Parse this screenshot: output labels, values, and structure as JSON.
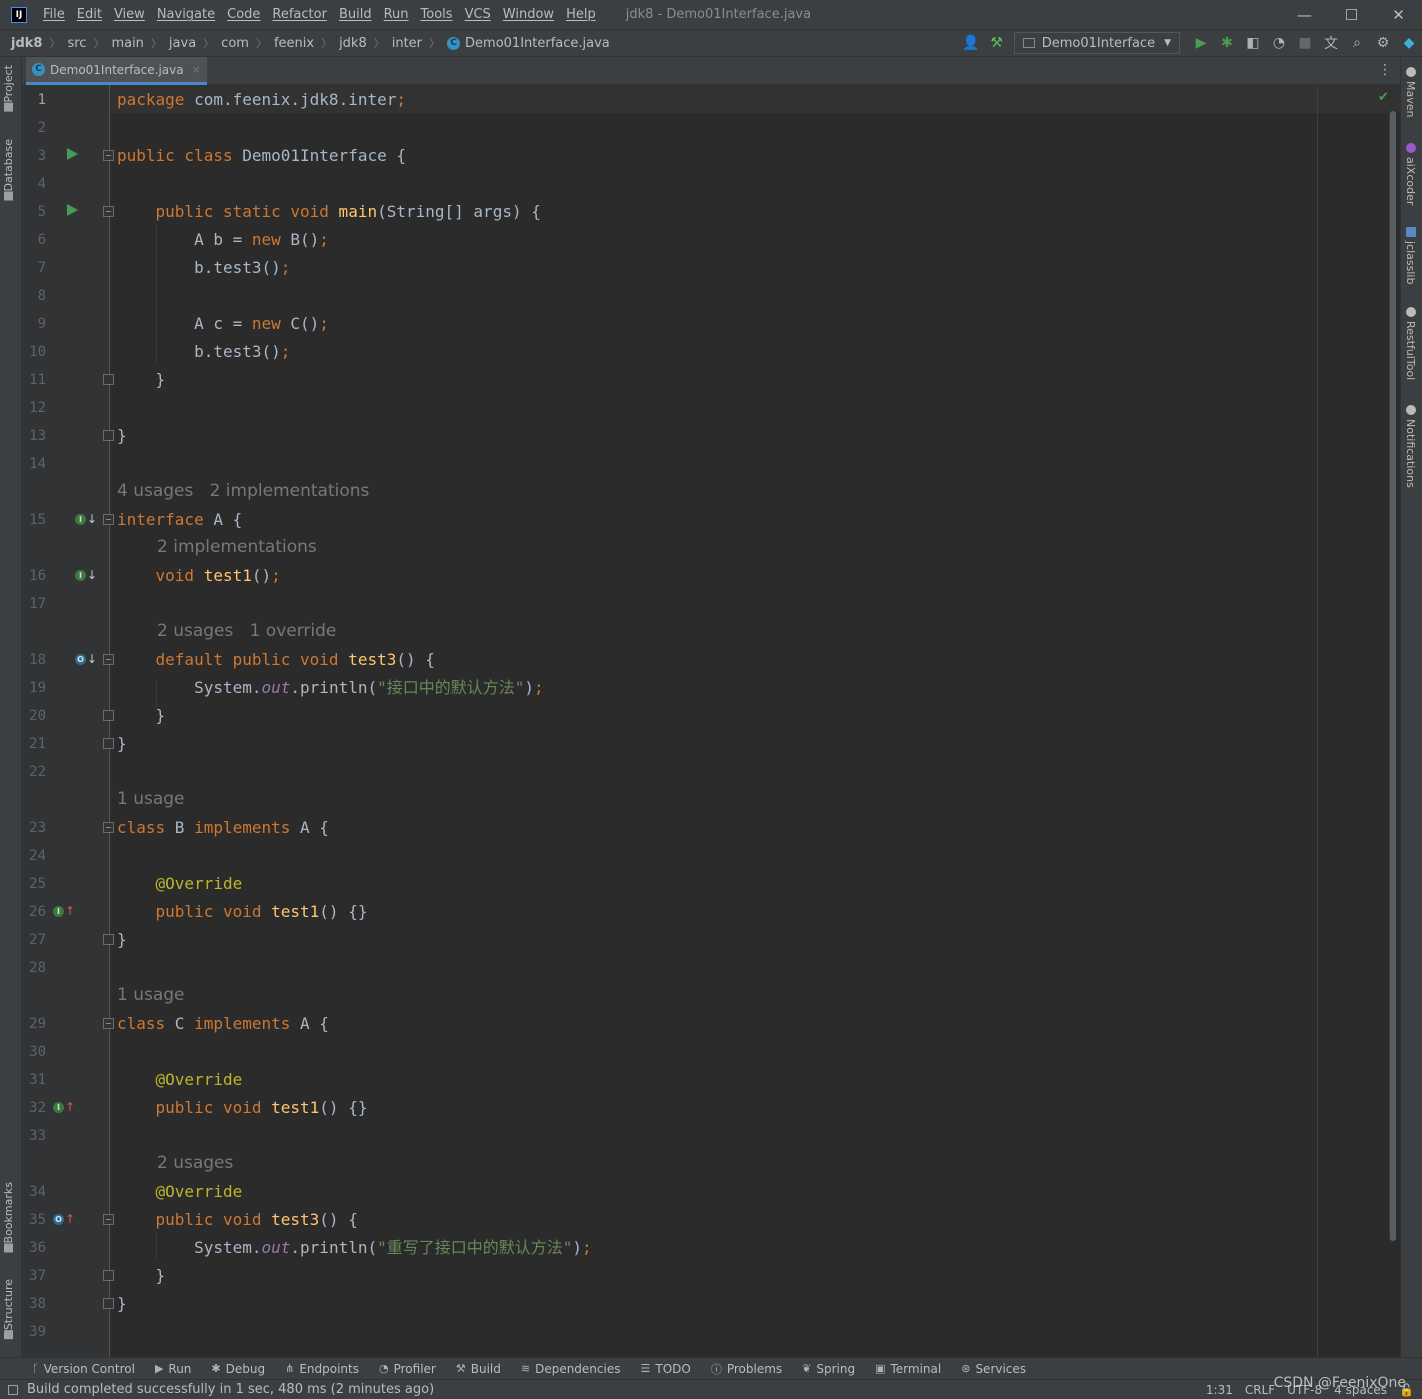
{
  "app": {
    "logo": "IJ",
    "window_title": "jdk8 - Demo01Interface.java",
    "menu": [
      "File",
      "Edit",
      "View",
      "Navigate",
      "Code",
      "Refactor",
      "Build",
      "Run",
      "Tools",
      "VCS",
      "Window",
      "Help"
    ],
    "controls": {
      "minimize": "—",
      "maximize": "☐",
      "close": "✕"
    }
  },
  "navbar": {
    "breadcrumbs": [
      "jdk8",
      "src",
      "main",
      "java",
      "com",
      "feenix",
      "jdk8",
      "inter"
    ],
    "file": "Demo01Interface.java",
    "run_config": "Demo01Interface"
  },
  "left_tools": [
    "Project",
    "Database",
    "Bookmarks",
    "Structure"
  ],
  "right_tools": [
    "Maven",
    "aiXcoder",
    "jclasslib",
    "RestfulTool",
    "Notifications"
  ],
  "editor_tab": {
    "label": "Demo01Interface.java",
    "close": "×"
  },
  "line_numbers": [
    "1",
    "2",
    "3",
    "4",
    "5",
    "6",
    "7",
    "8",
    "9",
    "10",
    "11",
    "12",
    "13",
    "14",
    "15",
    "16",
    "17",
    "18",
    "19",
    "20",
    "21",
    "22",
    "23",
    "24",
    "25",
    "26",
    "27",
    "28",
    "29",
    "30",
    "31",
    "32",
    "33",
    "34",
    "35",
    "36",
    "37",
    "38",
    "39"
  ],
  "hints": {
    "h15": "4 usages   2 implementations",
    "h16": "2 implementations",
    "h18": "2 usages   1 override",
    "h23": "1 usage",
    "h29": "1 usage",
    "h34": "2 usages"
  },
  "code": {
    "l1a": "package",
    "l1b": " com.feenix.jdk8.inter",
    "l1c": ";",
    "l3a": "public class",
    "l3b": " Demo01Interface {",
    "l5a": "    public static void",
    "l5b": " main",
    "l5c": "(String[] args) {",
    "l6a": "        A b = ",
    "l6b": "new",
    "l6c": " B()",
    "l6d": ";",
    "l7a": "        b.test3()",
    "l7b": ";",
    "l9a": "        A c = ",
    "l9b": "new",
    "l9c": " C()",
    "l9d": ";",
    "l10a": "        b.test3()",
    "l10b": ";",
    "l11": "    }",
    "l13": "}",
    "l15a": "interface",
    "l15b": " A {",
    "l16a": "    void",
    "l16b": " test1",
    "l16c": "()",
    "l16d": ";",
    "l18a": "    default public void",
    "l18b": " test3",
    "l18c": "() {",
    "l19a": "        System.",
    "l19b": "out",
    "l19c": ".println(",
    "l19d": "\"接口中的默认方法\"",
    "l19e": ")",
    "l19f": ";",
    "l20": "    }",
    "l21": "}",
    "l23a": "class",
    "l23b": " B ",
    "l23c": "implements",
    "l23d": " A {",
    "l25": "    @Override",
    "l26a": "    public void",
    "l26b": " test1",
    "l26c": "() {}",
    "l27": "}",
    "l29a": "class",
    "l29b": " C ",
    "l29c": "implements",
    "l29d": " A {",
    "l31": "    @Override",
    "l32a": "    public void",
    "l32b": " test1",
    "l32c": "() {}",
    "l34": "    @Override",
    "l35a": "    public void",
    "l35b": " test3",
    "l35c": "() {",
    "l36a": "        System.",
    "l36b": "out",
    "l36c": ".println(",
    "l36d": "\"重写了接口中的默认方法\"",
    "l36e": ")",
    "l36f": ";",
    "l37": "    }",
    "l38": "}"
  },
  "bottom_tools": [
    "Version Control",
    "Run",
    "Debug",
    "Endpoints",
    "Profiler",
    "Build",
    "Dependencies",
    "TODO",
    "Problems",
    "Spring",
    "Terminal",
    "Services"
  ],
  "status": {
    "message": "Build completed successfully in 1 sec, 480 ms (2 minutes ago)",
    "position": "1:31",
    "line_sep": "CRLF",
    "encoding": "UTF-8",
    "indent": "4 spaces"
  },
  "watermark": "CSDN @FeenixOne",
  "colors": {
    "background": "#2b2b2b",
    "keyword": "#cc7832",
    "method": "#ffc66d",
    "string": "#6a8759",
    "annotation": "#bbb529",
    "static_field": "#9876aa",
    "run_marker": "#499c54"
  }
}
